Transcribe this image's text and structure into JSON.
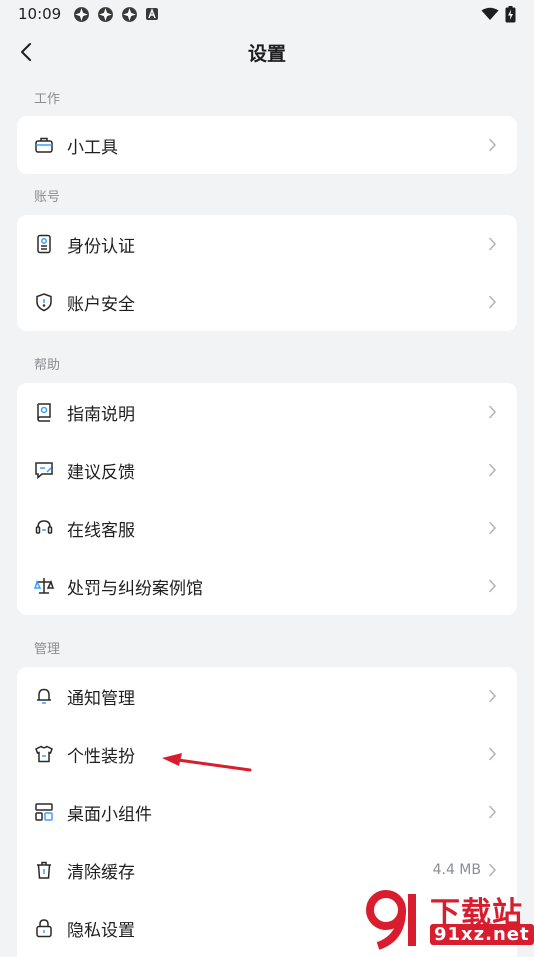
{
  "status_bar": {
    "time": "10:09"
  },
  "header": {
    "title": "设置"
  },
  "sections": [
    {
      "label": "工作",
      "items": [
        {
          "label": "小工具",
          "icon": "toolbox-icon"
        }
      ]
    },
    {
      "label": "账号",
      "items": [
        {
          "label": "身份认证",
          "icon": "id-card-icon"
        },
        {
          "label": "账户安全",
          "icon": "shield-icon"
        }
      ]
    },
    {
      "label": "帮助",
      "items": [
        {
          "label": "指南说明",
          "icon": "guide-book-icon"
        },
        {
          "label": "建议反馈",
          "icon": "feedback-icon"
        },
        {
          "label": "在线客服",
          "icon": "headset-icon"
        },
        {
          "label": "处罚与纠纷案例馆",
          "icon": "scales-icon"
        }
      ]
    },
    {
      "label": "管理",
      "items": [
        {
          "label": "通知管理",
          "icon": "bell-icon"
        },
        {
          "label": "个性装扮",
          "icon": "shirt-icon"
        },
        {
          "label": "桌面小组件",
          "icon": "widgets-icon"
        },
        {
          "label": "清除缓存",
          "icon": "trash-icon",
          "value": "4.4 MB"
        },
        {
          "label": "隐私设置",
          "icon": "lock-icon"
        }
      ]
    }
  ],
  "watermark": {
    "top": "下载站",
    "bottom": "91xz.net"
  },
  "colors": {
    "background": "#f2f3f5",
    "card": "#ffffff",
    "annotation": "#d81e2e"
  }
}
